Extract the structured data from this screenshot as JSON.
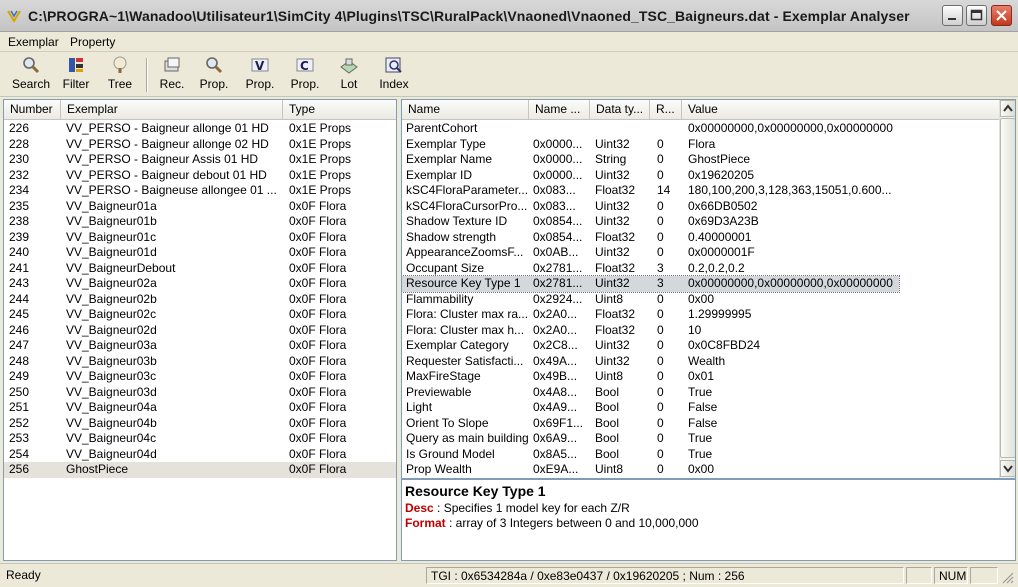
{
  "window": {
    "title": "C:\\PROGRA~1\\Wanadoo\\Utilisateur1\\SimCity 4\\Plugins\\TSC\\RuralPack\\Vnaoned\\Vnaoned_TSC_Baigneurs.dat - Exemplar Analyser"
  },
  "menu": [
    "Exemplar",
    "Property"
  ],
  "toolbar": [
    {
      "label": "Search",
      "icon": "search-icon"
    },
    {
      "label": "Filter",
      "icon": "filter-icon"
    },
    {
      "label": "Tree",
      "icon": "tree-icon"
    },
    {
      "label": "Rec.",
      "icon": "recolor-icon"
    },
    {
      "label": "Prop.",
      "icon": "prop-search-icon"
    },
    {
      "label": "Prop.",
      "icon": "prop-v-icon"
    },
    {
      "label": "Prop.",
      "icon": "prop-c-icon"
    },
    {
      "label": "Lot",
      "icon": "lot-icon"
    },
    {
      "label": "Index",
      "icon": "index-icon"
    }
  ],
  "exemplars": {
    "headers": [
      "Number",
      "Exemplar",
      "Type"
    ],
    "rows": [
      [
        "226",
        "VV_PERSO - Baigneur allonge 01 HD",
        "0x1E Props"
      ],
      [
        "228",
        "VV_PERSO - Baigneur allonge 02 HD",
        "0x1E Props"
      ],
      [
        "230",
        "VV_PERSO - Baigneur Assis 01 HD",
        "0x1E Props"
      ],
      [
        "232",
        "VV_PERSO - Baigneur debout 01 HD",
        "0x1E Props"
      ],
      [
        "234",
        "VV_PERSO - Baigneuse allongee 01 ...",
        "0x1E Props"
      ],
      [
        "235",
        "VV_Baigneur01a",
        "0x0F Flora"
      ],
      [
        "238",
        "VV_Baigneur01b",
        "0x0F Flora"
      ],
      [
        "239",
        "VV_Baigneur01c",
        "0x0F Flora"
      ],
      [
        "240",
        "VV_Baigneur01d",
        "0x0F Flora"
      ],
      [
        "241",
        "VV_BaigneurDebout",
        "0x0F Flora"
      ],
      [
        "243",
        "VV_Baigneur02a",
        "0x0F Flora"
      ],
      [
        "244",
        "VV_Baigneur02b",
        "0x0F Flora"
      ],
      [
        "245",
        "VV_Baigneur02c",
        "0x0F Flora"
      ],
      [
        "246",
        "VV_Baigneur02d",
        "0x0F Flora"
      ],
      [
        "247",
        "VV_Baigneur03a",
        "0x0F Flora"
      ],
      [
        "248",
        "VV_Baigneur03b",
        "0x0F Flora"
      ],
      [
        "249",
        "VV_Baigneur03c",
        "0x0F Flora"
      ],
      [
        "250",
        "VV_Baigneur03d",
        "0x0F Flora"
      ],
      [
        "251",
        "VV_Baigneur04a",
        "0x0F Flora"
      ],
      [
        "252",
        "VV_Baigneur04b",
        "0x0F Flora"
      ],
      [
        "253",
        "VV_Baigneur04c",
        "0x0F Flora"
      ],
      [
        "254",
        "VV_Baigneur04d",
        "0x0F Flora"
      ],
      [
        "256",
        "GhostPiece",
        "0x0F Flora"
      ]
    ],
    "selected_index": 22
  },
  "properties": {
    "headers": [
      "Name",
      "Name ...",
      "Data ty...",
      "R...",
      "Value"
    ],
    "rows": [
      [
        "ParentCohort",
        "",
        "",
        "",
        "0x00000000,0x00000000,0x00000000"
      ],
      [
        "Exemplar Type",
        "0x0000...",
        "Uint32",
        "0",
        "Flora"
      ],
      [
        "Exemplar Name",
        "0x0000...",
        "String",
        "0",
        "GhostPiece"
      ],
      [
        "Exemplar ID",
        "0x0000...",
        "Uint32",
        "0",
        "0x19620205"
      ],
      [
        "kSC4FloraParameter...",
        "0x083...",
        "Float32",
        "14",
        "180,100,200,3,128,363,15051,0.600..."
      ],
      [
        "kSC4FloraCursorPro...",
        "0x083...",
        "Uint32",
        "0",
        "0x66DB0502"
      ],
      [
        "Shadow Texture ID",
        "0x0854...",
        "Uint32",
        "0",
        "0x69D3A23B"
      ],
      [
        "Shadow strength",
        "0x0854...",
        "Float32",
        "0",
        "0.40000001"
      ],
      [
        "AppearanceZoomsF...",
        "0x0AB...",
        "Uint32",
        "0",
        "0x0000001F"
      ],
      [
        "Occupant Size",
        "0x2781...",
        "Float32",
        "3",
        "0.2,0.2,0.2"
      ],
      [
        "Resource Key Type 1",
        "0x2781...",
        "Uint32",
        "3",
        "0x00000000,0x00000000,0x00000000"
      ],
      [
        "Flammability",
        "0x2924...",
        "Uint8",
        "0",
        "0x00"
      ],
      [
        "Flora: Cluster max ra...",
        "0x2A0...",
        "Float32",
        "0",
        "1.29999995"
      ],
      [
        "Flora: Cluster max h...",
        "0x2A0...",
        "Float32",
        "0",
        "10"
      ],
      [
        "Exemplar Category",
        "0x2C8...",
        "Uint32",
        "0",
        "0x0C8FBD24"
      ],
      [
        "Requester Satisfacti...",
        "0x49A...",
        "Uint32",
        "0",
        "Wealth"
      ],
      [
        "MaxFireStage",
        "0x49B...",
        "Uint8",
        "0",
        "0x01"
      ],
      [
        "Previewable",
        "0x4A8...",
        "Bool",
        "0",
        "True"
      ],
      [
        "Light",
        "0x4A9...",
        "Bool",
        "0",
        "False"
      ],
      [
        "Orient To Slope",
        "0x69F1...",
        "Bool",
        "0",
        "False"
      ],
      [
        "Query as main building",
        "0x6A9...",
        "Bool",
        "0",
        "True"
      ],
      [
        "Is Ground Model",
        "0x8A5...",
        "Bool",
        "0",
        "True"
      ],
      [
        "Prop Wealth",
        "0xE9A...",
        "Uint8",
        "0",
        "0x00"
      ]
    ],
    "selected_index": 10
  },
  "description": {
    "title": "Resource Key Type 1",
    "desc_label": "Desc",
    "desc_text": " : Specifies 1 model key for each Z/R",
    "format_label": "Format",
    "format_text": " : array of 3 Integers between 0 and 10,000,000"
  },
  "status": {
    "ready": "Ready",
    "tgi": "TGI : 0x6534284a / 0xe83e0437 / 0x19620205 ; Num : 256",
    "num": "NUM"
  }
}
